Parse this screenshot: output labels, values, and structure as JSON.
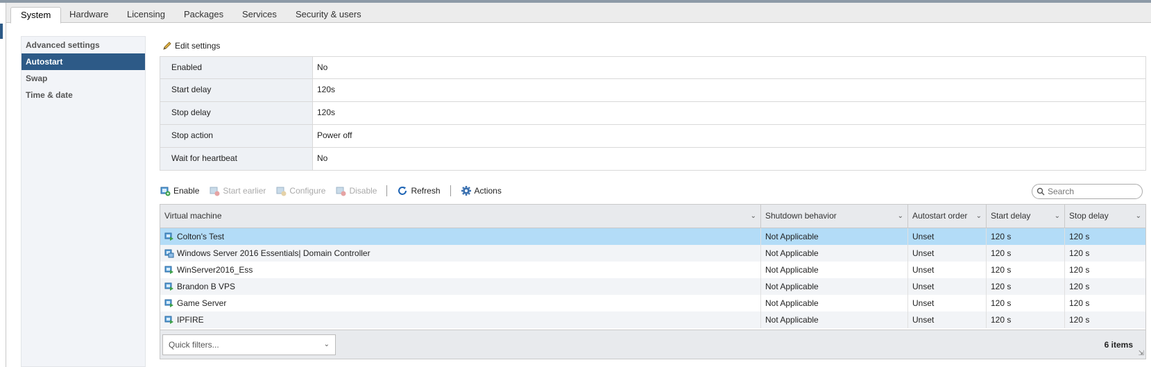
{
  "tabs": [
    "System",
    "Hardware",
    "Licensing",
    "Packages",
    "Services",
    "Security & users"
  ],
  "sidenav": [
    "Advanced settings",
    "Autostart",
    "Swap",
    "Time & date"
  ],
  "edit_settings": "Edit settings",
  "properties": [
    {
      "key": "Enabled",
      "value": "No"
    },
    {
      "key": "Start delay",
      "value": "120s"
    },
    {
      "key": "Stop delay",
      "value": "120s"
    },
    {
      "key": "Stop action",
      "value": "Power off"
    },
    {
      "key": "Wait for heartbeat",
      "value": "No"
    }
  ],
  "toolbar": {
    "enable": "Enable",
    "start_earlier": "Start earlier",
    "configure": "Configure",
    "disable": "Disable",
    "refresh": "Refresh",
    "actions": "Actions",
    "search_placeholder": "Search"
  },
  "columns": [
    "Virtual machine",
    "Shutdown behavior",
    "Autostart order",
    "Start delay",
    "Stop delay"
  ],
  "rows": [
    {
      "vm": "Colton's Test",
      "shutdown": "Not Applicable",
      "order": "Unset",
      "start": "120 s",
      "stop": "120 s"
    },
    {
      "vm": "Windows Server 2016 Essentials| Domain Controller",
      "shutdown": "Not Applicable",
      "order": "Unset",
      "start": "120 s",
      "stop": "120 s"
    },
    {
      "vm": "WinServer2016_Ess",
      "shutdown": "Not Applicable",
      "order": "Unset",
      "start": "120 s",
      "stop": "120 s"
    },
    {
      "vm": "Brandon B VPS",
      "shutdown": "Not Applicable",
      "order": "Unset",
      "start": "120 s",
      "stop": "120 s"
    },
    {
      "vm": "Game Server",
      "shutdown": "Not Applicable",
      "order": "Unset",
      "start": "120 s",
      "stop": "120 s"
    },
    {
      "vm": "IPFIRE",
      "shutdown": "Not Applicable",
      "order": "Unset",
      "start": "120 s",
      "stop": "120 s"
    }
  ],
  "quick_filters": "Quick filters...",
  "item_count": "6 items",
  "colors": {
    "accent": "#2d5a87",
    "selected_row": "#b3dcf7"
  }
}
